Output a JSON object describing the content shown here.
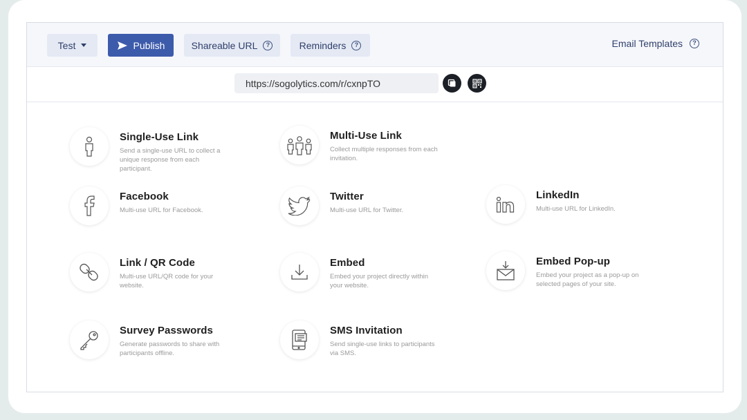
{
  "toolbar": {
    "test_label": "Test",
    "publish_label": "Publish",
    "shareable_label": "Shareable URL",
    "reminders_label": "Reminders",
    "email_templates_label": "Email Templates",
    "help_glyph": "?"
  },
  "url": {
    "value": "https://sogolytics.com/r/cxnpTO"
  },
  "options": [
    {
      "title": "Single-Use Link",
      "desc": "Send a single-use URL to collect a unique response from each participant.",
      "icon": "person-icon"
    },
    {
      "title": "Multi-Use Link",
      "desc": "Collect multiple responses from each invitation.",
      "icon": "people-icon"
    },
    {
      "title": "Facebook",
      "desc": "Multi-use URL for Facebook.",
      "icon": "facebook-icon"
    },
    {
      "title": "Twitter",
      "desc": "Multi-use URL for Twitter.",
      "icon": "twitter-icon"
    },
    {
      "title": "LinkedIn",
      "desc": "Multi-use URL for LinkedIn.",
      "icon": "linkedin-icon"
    },
    {
      "title": "Link / QR Code",
      "desc": "Multi-use URL/QR code for your website.",
      "icon": "link-icon"
    },
    {
      "title": "Embed",
      "desc": "Embed your project directly within your website.",
      "icon": "download-icon"
    },
    {
      "title": "Embed Pop-up",
      "desc": "Embed your project as a pop-up on selected pages of your site.",
      "icon": "mail-download-icon"
    },
    {
      "title": "Survey Passwords",
      "desc": "Generate passwords to share with participants offline.",
      "icon": "key-icon"
    },
    {
      "title": "SMS Invitation",
      "desc": "Send single-use links to participants via SMS.",
      "icon": "phone-sms-icon"
    }
  ],
  "colors": {
    "primary": "#3d5bab",
    "button_bg": "#e4e9f4",
    "toolbar_bg": "#f6f7fb",
    "text_dark": "#2f3f6b"
  }
}
